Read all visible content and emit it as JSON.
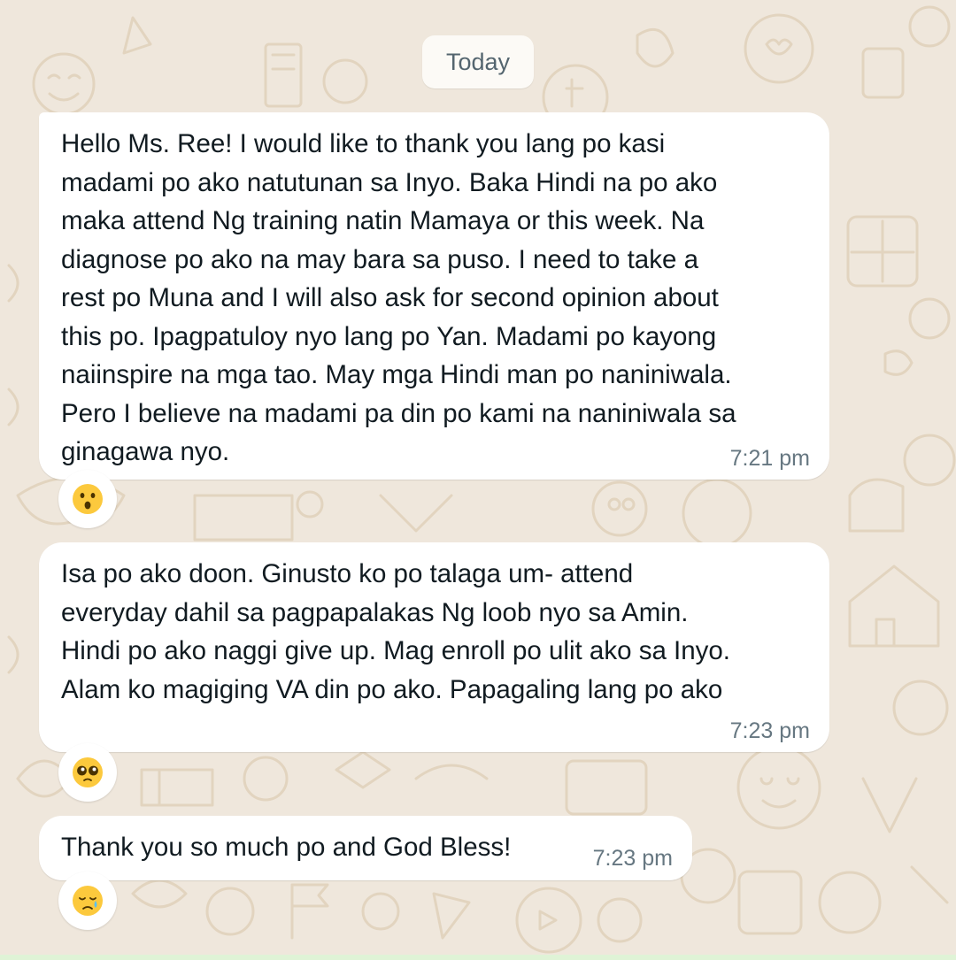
{
  "date_chip": "Today",
  "messages": [
    {
      "text": "Hello Ms. Ree! I would like to thank you lang po kasi\nmadami po ako natutunan sa Inyo. Baka Hindi na po ako\nmaka attend Ng training natin Mamaya or this week. Na\ndiagnose po ako na may bara sa puso. I need to take a\nrest po Muna and I will also ask for second opinion about\nthis po. Ipagpatuloy nyo lang po Yan. Madami po kayong\nnaiinspire na mga tao. May mga Hindi man po naniniwala.\nPero I believe na madami pa din po kami na naniniwala sa\nginagawa nyo.",
      "time": "7:21 pm",
      "reaction_icon": "hushed-face-emoji"
    },
    {
      "text": "Isa po ako doon. Ginusto ko po talaga um- attend\neveryday dahil sa pagpapalakas Ng loob nyo sa Amin.\nHindi po ako naggi give up. Mag enroll po ulit ako sa Inyo.\nAlam ko magiging VA din po ako. Papagaling lang po ako",
      "time": "7:23 pm",
      "reaction_icon": "pleading-face-emoji"
    },
    {
      "text": "Thank you so much po and God Bless!",
      "time": "7:23 pm",
      "reaction_icon": "sad-but-relieved-face-emoji"
    }
  ],
  "colors": {
    "wallpaper": "#efe7dc",
    "doodle": "#e4d6c3",
    "bubble": "#ffffff",
    "text": "#111b21",
    "timestamp": "#667781",
    "emoji_yellow": "#fcc93d"
  }
}
